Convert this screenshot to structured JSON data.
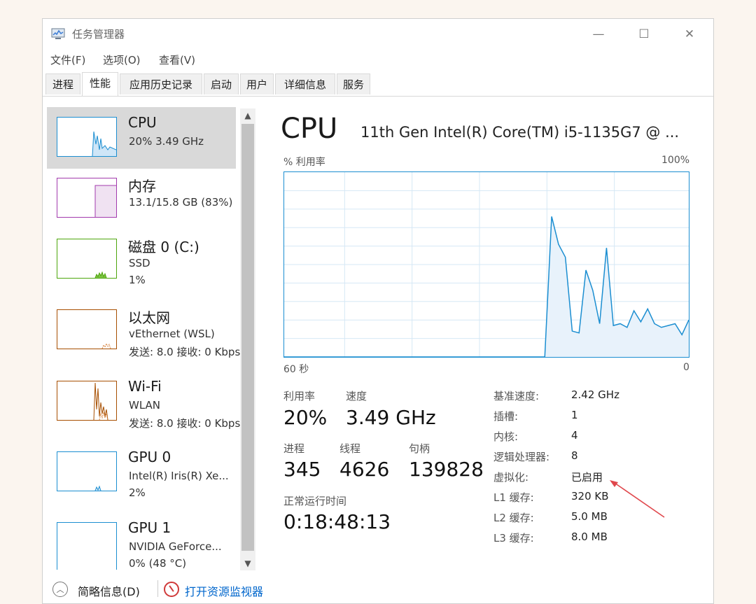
{
  "window": {
    "title": "任务管理器",
    "controls": {
      "minimize": "—",
      "maximize": "☐",
      "close": "✕"
    }
  },
  "menu": [
    "文件(F)",
    "选项(O)",
    "查看(V)"
  ],
  "tabs": [
    "进程",
    "性能",
    "应用历史记录",
    "启动",
    "用户",
    "详细信息",
    "服务"
  ],
  "active_tab": "性能",
  "sidebar": {
    "items": [
      {
        "name": "CPU",
        "line1": "20%  3.49 GHz",
        "line2": "",
        "color": "#1b8ed1"
      },
      {
        "name": "内存",
        "line1": "13.1/15.8 GB (83%)",
        "line2": "",
        "color": "#a23aad"
      },
      {
        "name": "磁盘 0 (C:)",
        "line1": "SSD",
        "line2": "1%",
        "color": "#4da60c"
      },
      {
        "name": "以太网",
        "line1": "vEthernet (WSL)",
        "line2": "发送: 8.0  接收: 0 Kbps",
        "color": "#a74f01"
      },
      {
        "name": "Wi-Fi",
        "line1": "WLAN",
        "line2": "发送: 8.0  接收: 0 Kbps",
        "color": "#a74f01"
      },
      {
        "name": "GPU 0",
        "line1": "Intel(R) Iris(R) Xe...",
        "line2": "2%",
        "color": "#1b8ed1"
      },
      {
        "name": "GPU 1",
        "line1": "NVIDIA GeForce...",
        "line2": "0% (48 °C)",
        "color": "#1b8ed1"
      }
    ]
  },
  "main": {
    "title": "CPU",
    "model": "11th Gen Intel(R) Core(TM) i5-1135G7 @ ...",
    "graph_label_left": "% 利用率",
    "graph_label_right": "100%",
    "axis_left": "60 秒",
    "axis_right": "0"
  },
  "chart_data": {
    "type": "area",
    "title": "% 利用率",
    "x_range": [
      60,
      0
    ],
    "ylim": [
      0,
      100
    ],
    "grid": true,
    "series": [
      {
        "values": [
          0,
          0,
          0,
          0,
          0,
          0,
          0,
          0,
          0,
          0,
          0,
          0,
          0,
          0,
          0,
          0,
          0,
          0,
          0,
          0,
          0,
          0,
          0,
          0,
          0,
          0,
          0,
          0,
          0,
          0,
          0,
          0,
          0,
          0,
          0,
          0,
          0,
          0,
          0,
          76,
          61,
          54,
          14,
          13,
          47,
          36,
          18,
          59,
          17,
          18,
          16,
          25,
          19,
          26,
          18,
          16,
          17,
          18,
          12,
          20
        ]
      }
    ]
  },
  "stats": {
    "utilization": {
      "label": "利用率",
      "value": "20%"
    },
    "speed": {
      "label": "速度",
      "value": "3.49 GHz"
    },
    "processes": {
      "label": "进程",
      "value": "345"
    },
    "threads": {
      "label": "线程",
      "value": "4626"
    },
    "handles": {
      "label": "句柄",
      "value": "139828"
    },
    "uptime": {
      "label": "正常运行时间",
      "value": "0:18:48:13"
    }
  },
  "specs": [
    {
      "label": "基准速度:",
      "value": "2.42 GHz"
    },
    {
      "label": "插槽:",
      "value": "1"
    },
    {
      "label": "内核:",
      "value": "4"
    },
    {
      "label": "逻辑处理器:",
      "value": "8"
    },
    {
      "label": "虚拟化:",
      "value": "已启用"
    },
    {
      "label": "L1 缓存:",
      "value": "320 KB"
    },
    {
      "label": "L2 缓存:",
      "value": "5.0 MB"
    },
    {
      "label": "L3 缓存:",
      "value": "8.0 MB"
    }
  ],
  "footer": {
    "brief": "简略信息(D)",
    "monitor": "打开资源监视器",
    "link_color": "#0066cc"
  },
  "annotation_color": "#e0474c"
}
